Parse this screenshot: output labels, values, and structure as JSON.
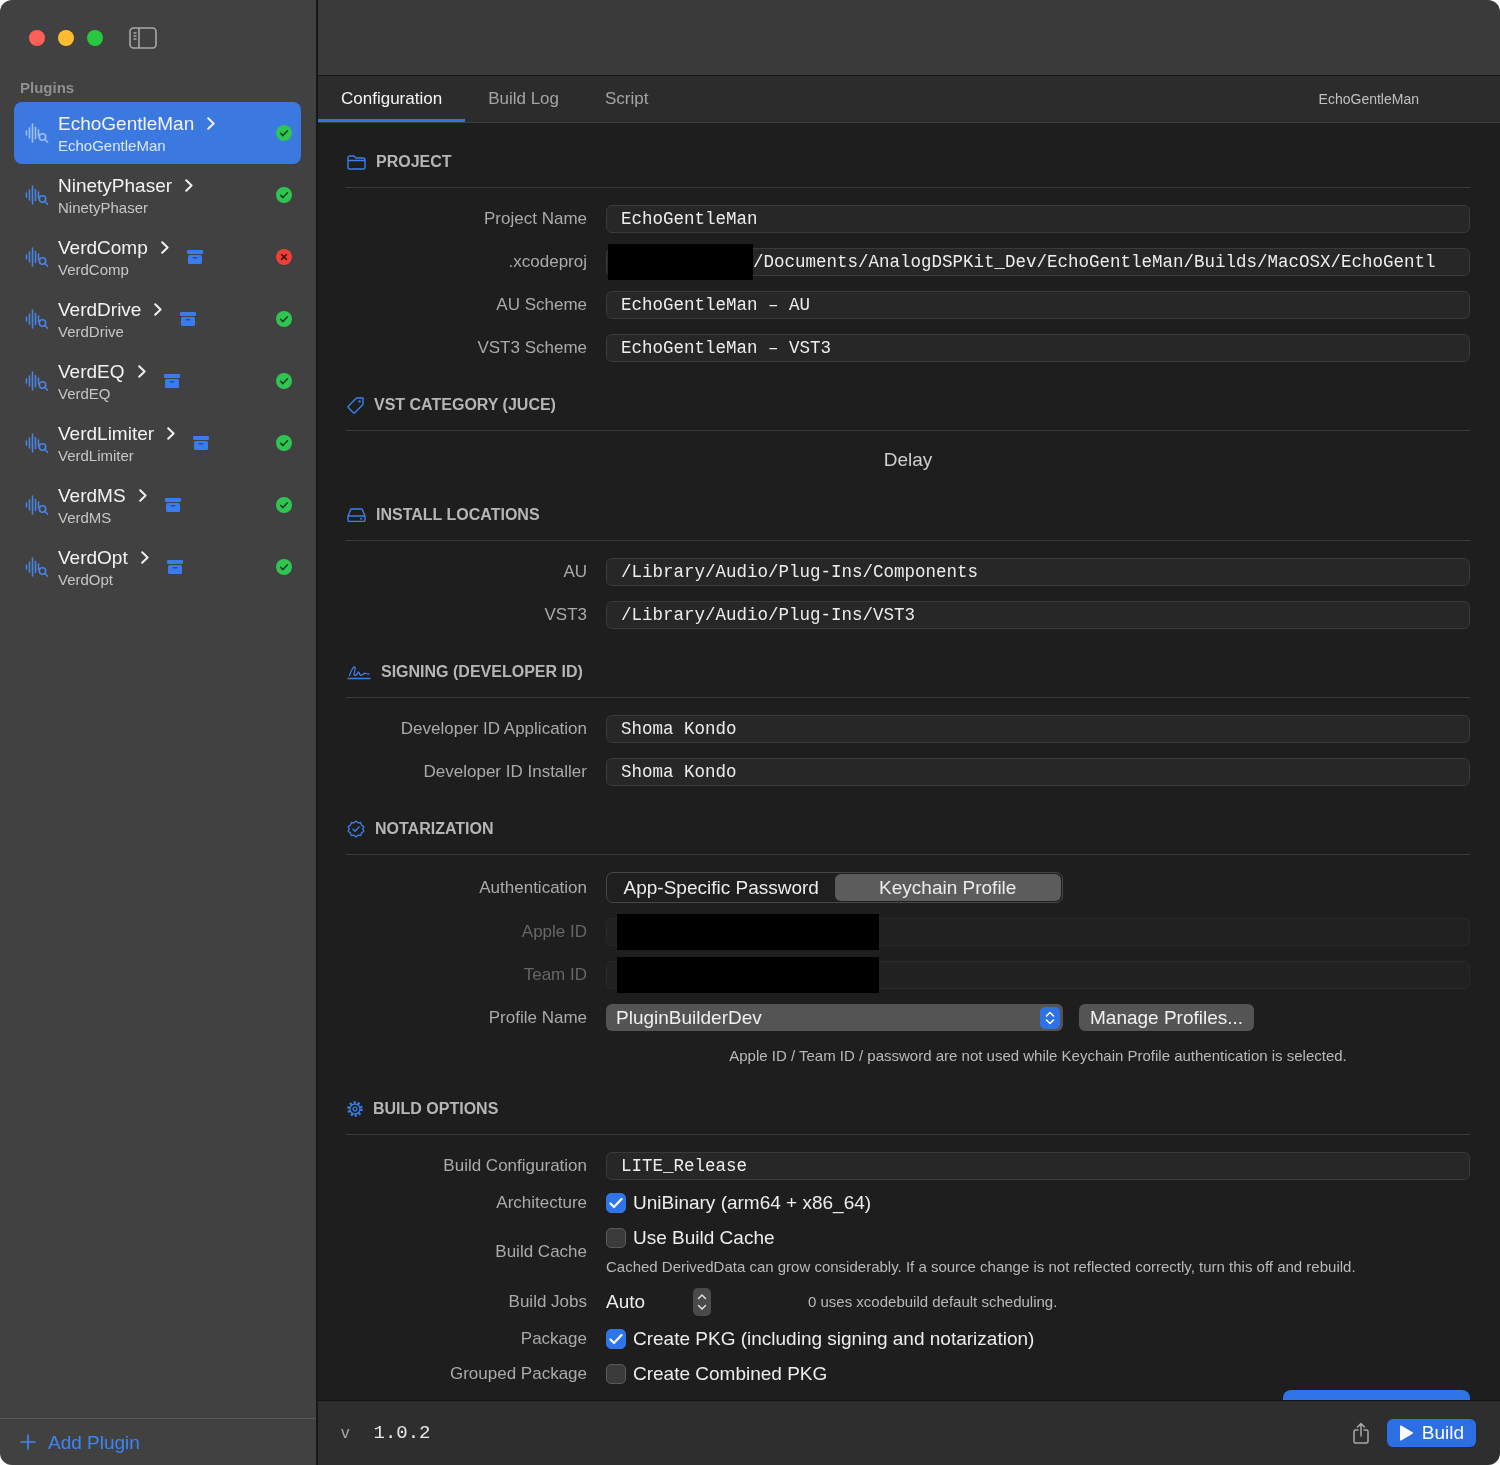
{
  "sidebar": {
    "heading": "Plugins",
    "items": [
      {
        "name": "EchoGentleMan",
        "subtitle": "EchoGentleMan",
        "selected": true,
        "archived": false,
        "succeeded": true
      },
      {
        "name": "NinetyPhaser",
        "subtitle": "NinetyPhaser",
        "selected": false,
        "archived": false,
        "succeeded": true
      },
      {
        "name": "VerdComp",
        "subtitle": "VerdComp",
        "selected": false,
        "archived": true,
        "succeeded": false
      },
      {
        "name": "VerdDrive",
        "subtitle": "VerdDrive",
        "selected": false,
        "archived": true,
        "succeeded": true
      },
      {
        "name": "VerdEQ",
        "subtitle": "VerdEQ",
        "selected": false,
        "archived": true,
        "succeeded": true
      },
      {
        "name": "VerdLimiter",
        "subtitle": "VerdLimiter",
        "selected": false,
        "archived": true,
        "succeeded": true
      },
      {
        "name": "VerdMS",
        "subtitle": "VerdMS",
        "selected": false,
        "archived": true,
        "succeeded": true
      },
      {
        "name": "VerdOpt",
        "subtitle": "VerdOpt",
        "selected": false,
        "archived": true,
        "succeeded": true
      }
    ],
    "add_button": "Add Plugin"
  },
  "tabs": [
    {
      "label": "Configuration",
      "selected": true
    },
    {
      "label": "Build Log",
      "selected": false
    },
    {
      "label": "Script",
      "selected": false
    }
  ],
  "tab_bar_title": "EchoGentleMan",
  "sections": [
    {
      "title": "PROJECT",
      "rows": [
        {
          "kind": "text",
          "label": "Project Name",
          "value": "EchoGentleMan"
        },
        {
          "kind": "redacted-path",
          "label": ".xcodeproj",
          "value": "/Documents/AnalogDSPKit_Dev/EchoGentleMan/Builds/MacOSX/EchoGentl"
        },
        {
          "kind": "text",
          "label": "AU Scheme",
          "value": "EchoGentleMan – AU"
        },
        {
          "kind": "text",
          "label": "VST3 Scheme",
          "value": "EchoGentleMan – VST3"
        }
      ]
    },
    {
      "title": "VST CATEGORY (JUCE)",
      "rows": [
        {
          "kind": "center",
          "value": "Delay"
        }
      ]
    },
    {
      "title": "INSTALL LOCATIONS",
      "rows": [
        {
          "kind": "text",
          "label": "AU",
          "value": "/Library/Audio/Plug-Ins/Components"
        },
        {
          "kind": "text",
          "label": "VST3",
          "value": "/Library/Audio/Plug-Ins/VST3"
        }
      ]
    },
    {
      "title": "SIGNING (DEVELOPER ID)",
      "rows": [
        {
          "kind": "text",
          "label": "Developer ID Application",
          "value": "Shoma Kondo"
        },
        {
          "kind": "text",
          "label": "Developer ID Installer",
          "value": "Shoma Kondo"
        }
      ]
    },
    {
      "title": "NOTARIZATION",
      "rows": [
        {
          "kind": "segmented",
          "label": "Authentication",
          "disabled": false,
          "options": [
            {
              "label": "App-Specific Password",
              "selected": false
            },
            {
              "label": "Keychain Profile",
              "selected": true
            }
          ]
        },
        {
          "kind": "redacted",
          "label": "Apple ID",
          "disabled": true
        },
        {
          "kind": "redacted",
          "label": "Team ID",
          "disabled": true
        },
        {
          "kind": "popup",
          "label": "Profile Name",
          "disabled": false,
          "value": "PluginBuilderDev",
          "button": "Manage Profiles..."
        },
        {
          "kind": "note",
          "disabled": false,
          "value": "Apple ID / Team ID / password are not used while Keychain Profile authentication is selected."
        }
      ]
    },
    {
      "title": "BUILD OPTIONS",
      "rows": [
        {
          "kind": "text",
          "label": "Build Configuration",
          "value": "LITE_Release"
        },
        {
          "kind": "checkbox",
          "label": "Architecture",
          "option": "UniBinary (arm64 + x86_64)",
          "checked": true
        },
        {
          "kind": "checkbox",
          "label": "Build Cache",
          "option": "Use Build Cache",
          "checked": false,
          "note": "Cached DerivedData can grow considerably. If a source change is not reflected correctly, turn this off and rebuild."
        },
        {
          "kind": "stepper",
          "label": "Build Jobs",
          "value": "Auto",
          "note": "0 uses xcodebuild default scheduling."
        },
        {
          "kind": "checkbox",
          "label": "Package",
          "option": "Create PKG (including signing and notarization)",
          "checked": true
        },
        {
          "kind": "checkbox",
          "label": "Grouped Package",
          "option": "Create Combined PKG",
          "checked": false
        }
      ]
    }
  ],
  "footer": {
    "version_prefix": "v",
    "version": "1.0.2",
    "build_button": "Build"
  }
}
